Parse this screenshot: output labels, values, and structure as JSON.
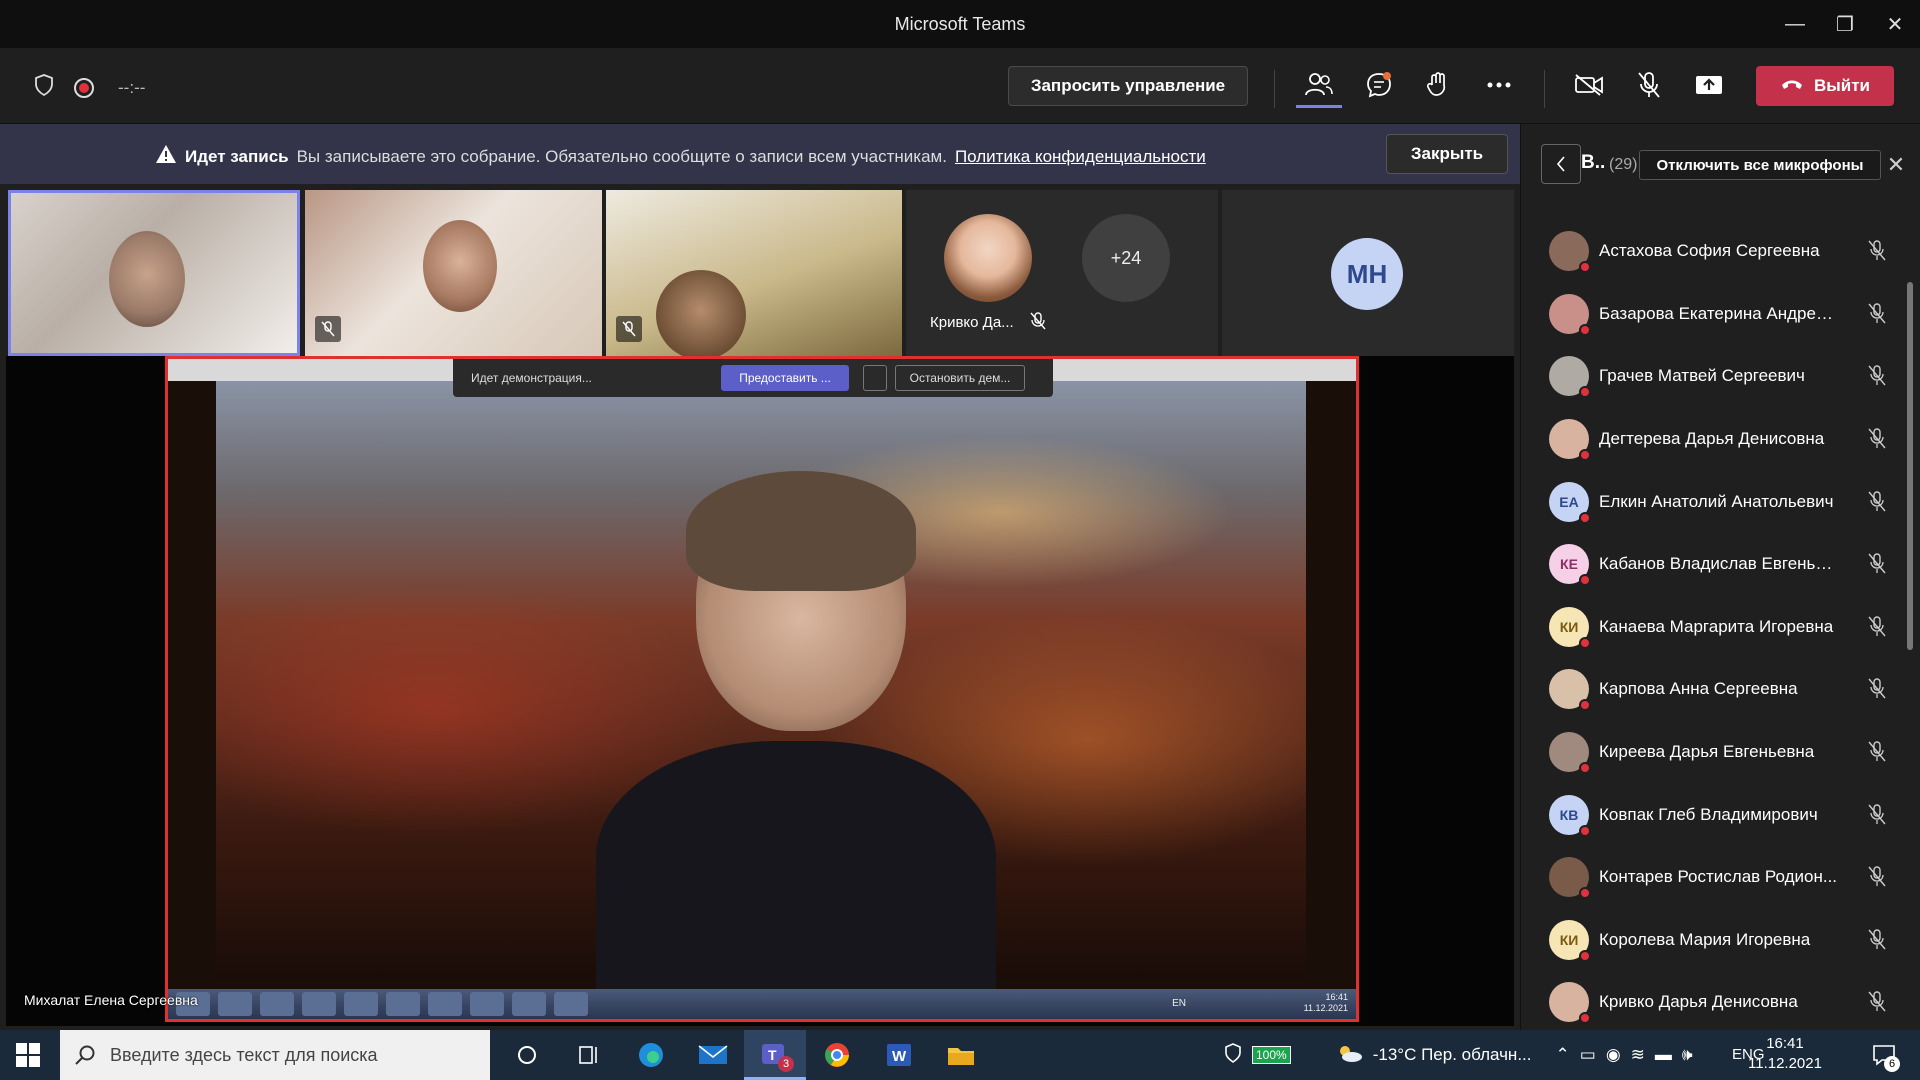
{
  "window": {
    "title": "Microsoft Teams"
  },
  "toolbar": {
    "timer": "--:--",
    "request_control": "Запросить управление",
    "leave": "Выйти"
  },
  "banner": {
    "bold": "Идет запись",
    "text": "Вы записываете это собрание. Обязательно сообщите о записи всем участникам.",
    "link": "Политика конфиденциальности",
    "close": "Закрыть"
  },
  "tiles": {
    "small_name": "Кривко Да...",
    "more_count": "+24",
    "initials": "МН"
  },
  "share": {
    "demo_label": "Идет демонстрация...",
    "give_control": "Предоставить ...",
    "stop": "Остановить дем...",
    "inner_lang": "EN",
    "inner_time": "16:41",
    "inner_date": "11.12.2021",
    "presenter": "Михалат Елена Сергеевна"
  },
  "panel": {
    "title": "В..",
    "count": "(29)",
    "mute_all": "Отключить все микрофоны",
    "participants": [
      {
        "name": "Астахова София Сергеевна",
        "initials": "",
        "bg": "#8a6a5a"
      },
      {
        "name": "Базарова Екатерина Андрее...",
        "initials": "",
        "bg": "#c9908a"
      },
      {
        "name": "Грачев Матвей Сергеевич",
        "initials": "",
        "bg": "#b0aaa4"
      },
      {
        "name": "Дегтерева Дарья Денисовна",
        "initials": "",
        "bg": "#d8b4a0"
      },
      {
        "name": "Елкин Анатолий Анатольевич",
        "initials": "ЕА",
        "bg": "#c5d4f5",
        "fg": "#2e4a8c"
      },
      {
        "name": "Кабанов Владислав Евгенье...",
        "initials": "КЕ",
        "bg": "#f5d0e6",
        "fg": "#8c2e6a"
      },
      {
        "name": "Канаева Маргарита Игоревна",
        "initials": "КИ",
        "bg": "#f7e6b5",
        "fg": "#7a5a10"
      },
      {
        "name": "Карпова Анна Сергеевна",
        "initials": "",
        "bg": "#d9c0a8"
      },
      {
        "name": "Киреева Дарья Евгеньевна",
        "initials": "",
        "bg": "#a08a80"
      },
      {
        "name": "Ковпак Глеб Владимирович",
        "initials": "КВ",
        "bg": "#c5d4f5",
        "fg": "#2e4a8c"
      },
      {
        "name": "Контарев Ростислав Родион...",
        "initials": "",
        "bg": "#7a5a48"
      },
      {
        "name": "Королева Мария Игоревна",
        "initials": "КИ",
        "bg": "#f7e6b5",
        "fg": "#7a5a10"
      },
      {
        "name": "Кривко Дарья Денисовна",
        "initials": "",
        "bg": "#d8b4a0"
      }
    ]
  },
  "taskbar": {
    "search_placeholder": "Введите здесь текст для поиска",
    "battery": "100%",
    "weather": "-13°C  Пер. облачн...",
    "lang": "ENG",
    "time": "16:41",
    "date": "11.12.2021",
    "teams_badge": "3",
    "notifications": "6"
  },
  "colors": {
    "accent": "#7b83eb",
    "leave": "#c4314b",
    "banner": "#33344a",
    "recording": "#e0323c"
  }
}
